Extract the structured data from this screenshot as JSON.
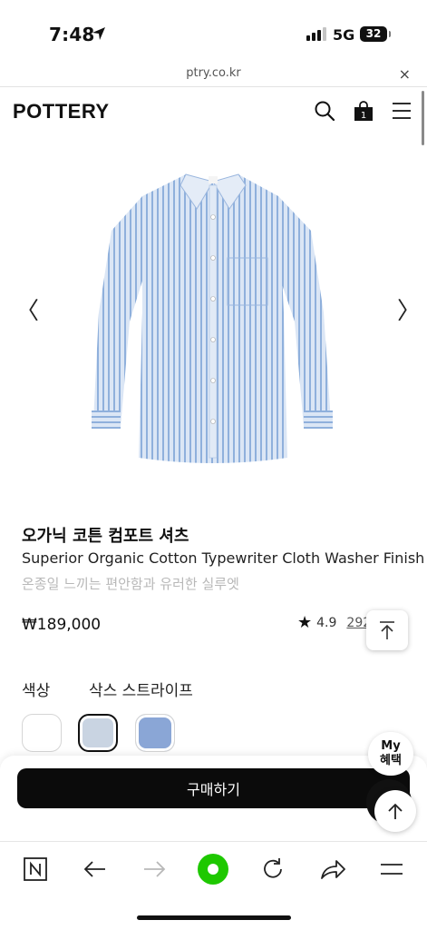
{
  "status": {
    "time": "7:48",
    "network": "5G",
    "battery": "32"
  },
  "browser": {
    "url": "ptry.co.kr",
    "close_label": "×"
  },
  "header": {
    "logo": "POTTERY",
    "cart_count": "1"
  },
  "gallery": {
    "prev": "〈",
    "next": "〉"
  },
  "product": {
    "name_ko": "오가닉 코튼 컴포트 셔츠",
    "name_en": "Superior Organic Cotton Typewriter Cloth Washer Finish",
    "description": "온종일 느끼는 편안함과 유러한 실루엣",
    "price": "₩189,000",
    "rating": "4.9",
    "review_count": "292"
  },
  "options": {
    "color_label": "색상",
    "selected_color": "삭스 스트라이프",
    "swatches": [
      "#ffffff",
      "#c9d4e2",
      "#8aa6d6"
    ]
  },
  "purchase": {
    "buy_label": "구매하기",
    "benefit_label_1": "My",
    "benefit_label_2": "혜택"
  },
  "colors": {
    "accent": "#0b0b0b",
    "green": "#1ec800"
  }
}
